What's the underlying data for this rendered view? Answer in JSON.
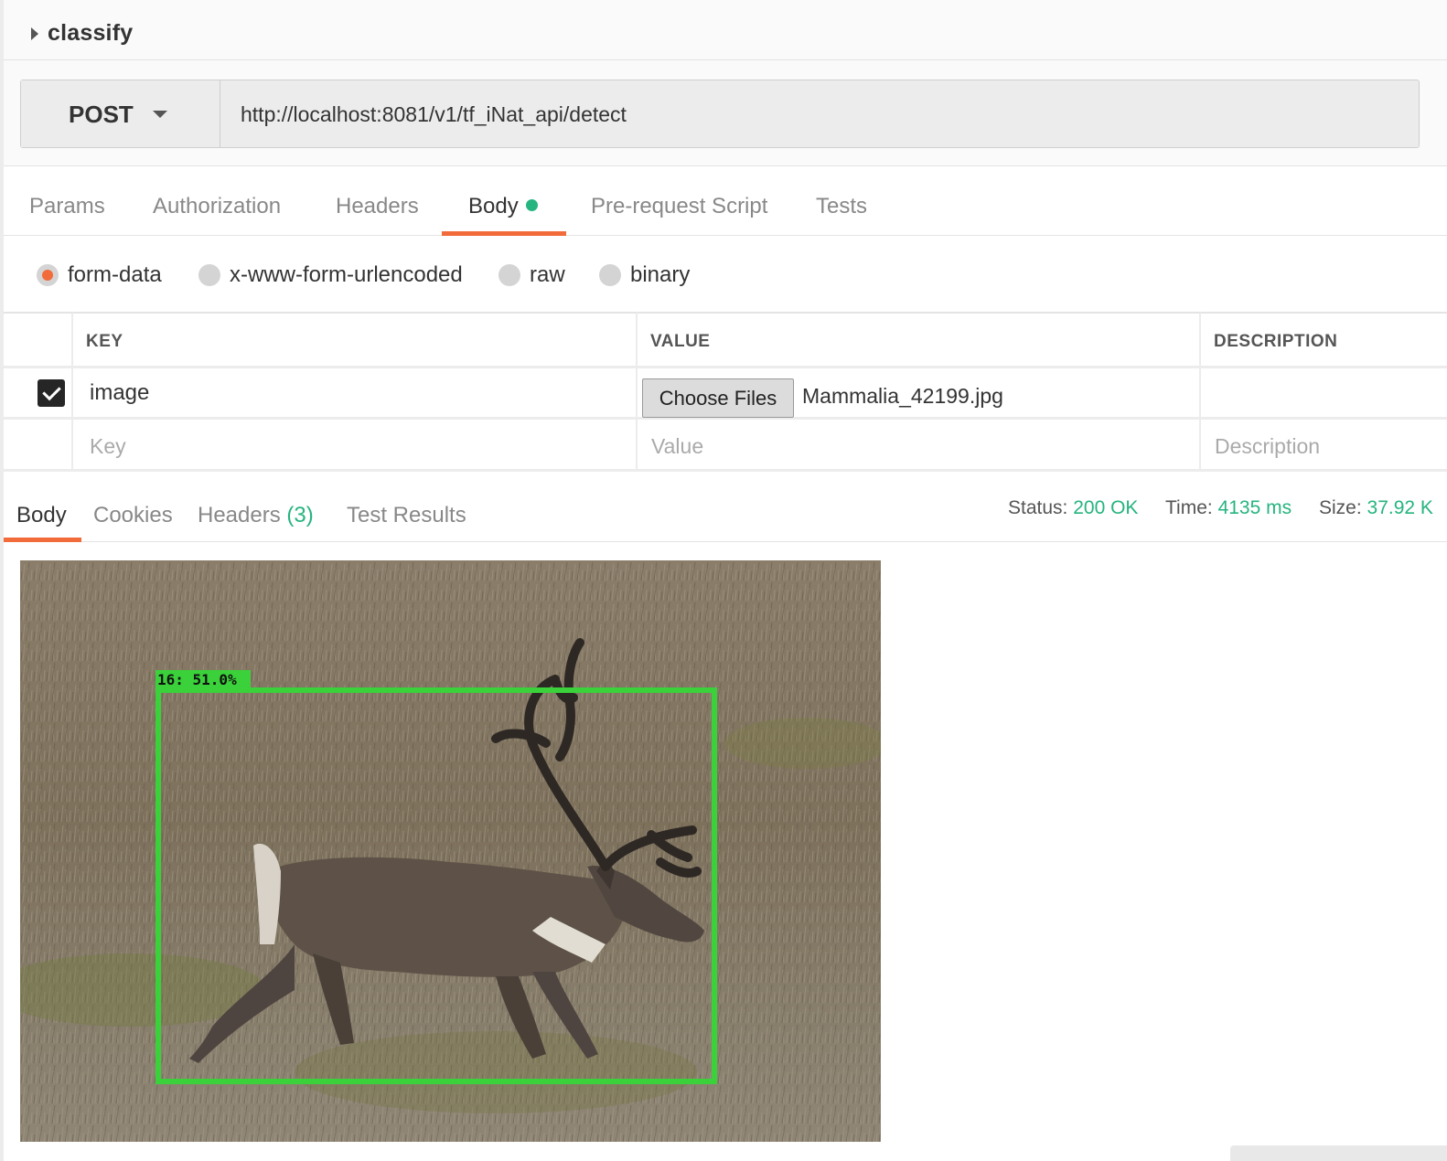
{
  "collection": {
    "title": "classify"
  },
  "request": {
    "method": "POST",
    "url": "http://localhost:8081/v1/tf_iNat_api/detect"
  },
  "request_tabs": [
    {
      "label": "Params",
      "active": false
    },
    {
      "label": "Authorization",
      "active": false
    },
    {
      "label": "Headers",
      "active": false
    },
    {
      "label": "Body",
      "active": true,
      "indicator": "green-dot"
    },
    {
      "label": "Pre-request Script",
      "active": false
    },
    {
      "label": "Tests",
      "active": false
    }
  ],
  "body_types": [
    {
      "label": "form-data",
      "selected": true
    },
    {
      "label": "x-www-form-urlencoded",
      "selected": false
    },
    {
      "label": "raw",
      "selected": false
    },
    {
      "label": "binary",
      "selected": false
    }
  ],
  "params_table": {
    "headers": [
      "KEY",
      "VALUE",
      "DESCRIPTION"
    ],
    "rows": [
      {
        "checked": true,
        "key": "image",
        "value_button": "Choose Files",
        "value_file": "Mammalia_42199.jpg",
        "description": ""
      }
    ],
    "placeholders": {
      "key": "Key",
      "value": "Value",
      "description": "Description"
    }
  },
  "response_tabs": [
    {
      "label": "Body",
      "active": true
    },
    {
      "label": "Cookies",
      "active": false
    },
    {
      "label": "Headers",
      "count": "(3)",
      "active": false
    },
    {
      "label": "Test Results",
      "active": false
    }
  ],
  "response_meta": {
    "status_label": "Status:",
    "status_value": "200 OK",
    "time_label": "Time:",
    "time_value": "4135 ms",
    "size_label": "Size:",
    "size_value": "37.92 K"
  },
  "detection": {
    "label": "16: 51.0%",
    "box_color": "#3ad13a"
  },
  "colors": {
    "accent": "#f26b3a",
    "success": "#26b47f"
  }
}
